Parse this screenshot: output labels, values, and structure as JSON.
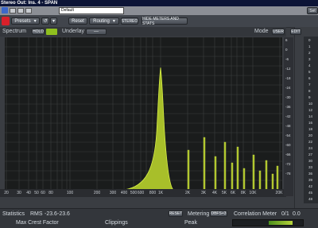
{
  "window_title": "Stereo Out: Ins. 4 - SPAN",
  "host": {
    "preset_field": "Default",
    "presets_label": "Presets",
    "setup_label": "Set"
  },
  "toolbar": {
    "reset_label": "Reset",
    "routing_label": "Routing",
    "stereo_label": "STEREO",
    "hide_meters_label": "HIDE METERS AND STATS"
  },
  "spectrum_header": {
    "spectrum_label": "Spectrum",
    "hold_label": "HOLD",
    "underlay_label": "Underlay",
    "underlay_value": "---",
    "mode_label": "Mode",
    "mode_value": "USER",
    "edit_label": "EDIT"
  },
  "freq_ticks": [
    "20",
    "30",
    "40",
    "50",
    "60",
    "80",
    "100",
    "200",
    "300",
    "400",
    "500",
    "600",
    "800",
    "1K",
    "2K",
    "3K",
    "4K",
    "5K",
    "6K",
    "8K",
    "10K",
    "20K"
  ],
  "db_ticks": [
    "6",
    "0",
    "-6",
    "-12",
    "-18",
    "-24",
    "-30",
    "-36",
    "-42",
    "-48",
    "-54",
    "-60",
    "-66",
    "-72",
    "-78"
  ],
  "meter_ticks": [
    "0",
    "1",
    "2",
    "3",
    "4",
    "5",
    "6",
    "7",
    "8",
    "9",
    "10",
    "12",
    "14",
    "16",
    "18",
    "20",
    "22",
    "24",
    "27",
    "30",
    "33",
    "36",
    "39",
    "42",
    "45",
    "48"
  ],
  "statistics": {
    "label": "Statistics",
    "rms_label": "RMS",
    "rms_left": "-23.6",
    "rms_right": "-23.6",
    "reset_label": "RESET",
    "metering_label": "Metering",
    "metering_value": "DBFS+3",
    "max_crest_label": "Max Crest Factor",
    "clippings_label": "Clippings",
    "peak_label": "Peak"
  },
  "correlation": {
    "label": "Correlation Meter",
    "value_a": "0/1",
    "value_b": "0.0"
  },
  "colors": {
    "spectrum_fill": "#a8bf2a",
    "spectrum_line": "#d6ee45",
    "hold_indicator": "#8fbf1e"
  }
}
